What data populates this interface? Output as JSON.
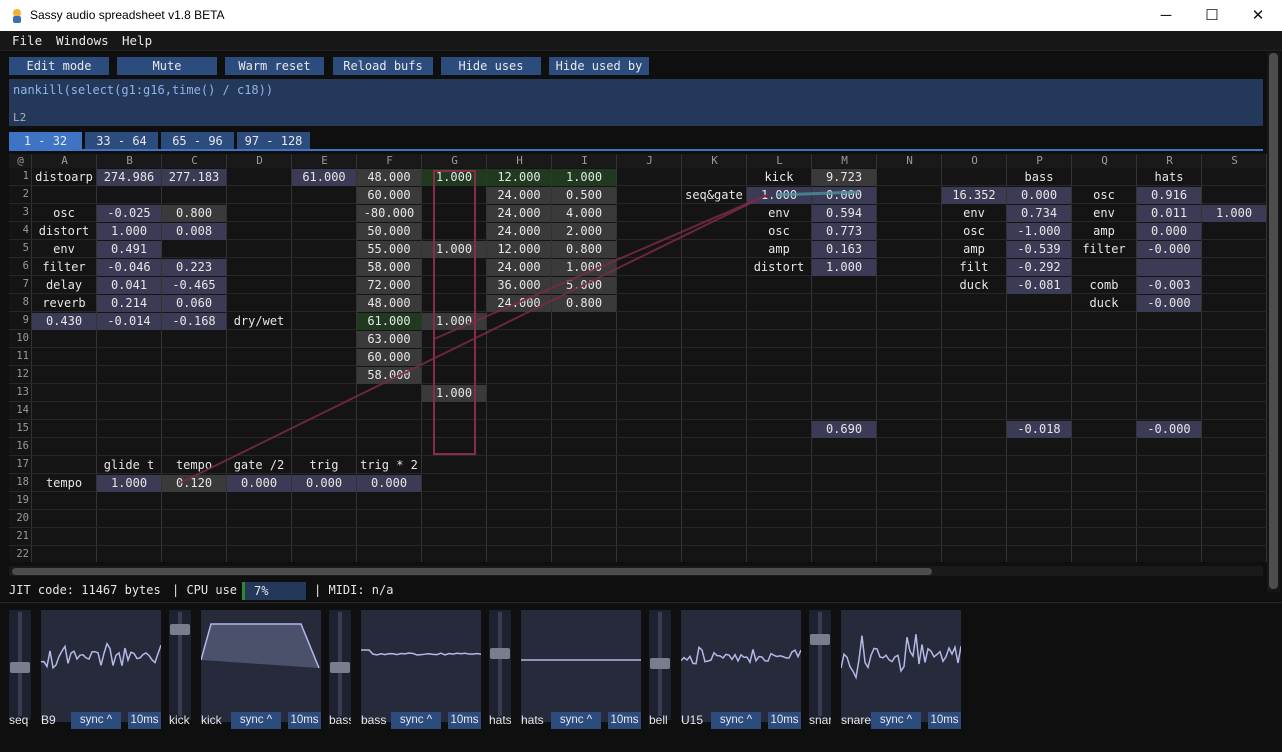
{
  "window": {
    "title": "Sassy audio spreadsheet v1.8 BETA",
    "min": "─",
    "max": "☐",
    "close": "✕"
  },
  "menu": [
    "File",
    "Windows",
    "Help"
  ],
  "toolbar": [
    "Edit mode",
    "Mute",
    "Warm reset",
    "Reload bufs",
    "Hide uses",
    "Hide used by"
  ],
  "formula": {
    "expression": "nankill(select(g1:g16,time() / c18))",
    "cell_ref": "L2"
  },
  "tabs": [
    "1 - 32",
    "33 - 64",
    "65 - 96",
    "97 - 128"
  ],
  "grid": {
    "corner": "@",
    "columns": [
      "A",
      "B",
      "C",
      "D",
      "E",
      "F",
      "G",
      "H",
      "I",
      "J",
      "K",
      "L",
      "M",
      "N",
      "O",
      "P",
      "Q",
      "R",
      "S"
    ],
    "rows": [
      "1",
      "2",
      "3",
      "4",
      "5",
      "6",
      "7",
      "8",
      "9",
      "10",
      "11",
      "12",
      "13",
      "14",
      "15",
      "16",
      "17",
      "18",
      "19",
      "20",
      "21",
      "22"
    ],
    "cells": [
      {
        "c": 0,
        "r": 0,
        "v": "distoarp",
        "s": "t"
      },
      {
        "c": 1,
        "r": 0,
        "v": "274.986",
        "s": "n"
      },
      {
        "c": 2,
        "r": 0,
        "v": "277.183",
        "s": "n"
      },
      {
        "c": 4,
        "r": 0,
        "v": "61.000",
        "s": "n"
      },
      {
        "c": 5,
        "r": 0,
        "v": "48.000",
        "s": "g"
      },
      {
        "c": 6,
        "r": 0,
        "v": "1.000",
        "s": "gr"
      },
      {
        "c": 7,
        "r": 0,
        "v": "12.000",
        "s": "gr"
      },
      {
        "c": 8,
        "r": 0,
        "v": "1.000",
        "s": "gr"
      },
      {
        "c": 11,
        "r": 0,
        "v": "kick",
        "s": "t"
      },
      {
        "c": 12,
        "r": 0,
        "v": "9.723",
        "s": "g"
      },
      {
        "c": 15,
        "r": 0,
        "v": "bass",
        "s": "t"
      },
      {
        "c": 17,
        "r": 0,
        "v": "hats",
        "s": "t"
      },
      {
        "c": 5,
        "r": 1,
        "v": "60.000",
        "s": "g"
      },
      {
        "c": 7,
        "r": 1,
        "v": "24.000",
        "s": "g"
      },
      {
        "c": 8,
        "r": 1,
        "v": "0.500",
        "s": "g"
      },
      {
        "c": 10,
        "r": 1,
        "v": "seq&gate",
        "s": "t"
      },
      {
        "c": 11,
        "r": 1,
        "v": "1.000",
        "s": "n"
      },
      {
        "c": 12,
        "r": 1,
        "v": "0.000",
        "s": "n"
      },
      {
        "c": 14,
        "r": 1,
        "v": "16.352",
        "s": "n"
      },
      {
        "c": 15,
        "r": 1,
        "v": "0.000",
        "s": "n"
      },
      {
        "c": 16,
        "r": 1,
        "v": "osc",
        "s": "t"
      },
      {
        "c": 17,
        "r": 1,
        "v": "0.916",
        "s": "n"
      },
      {
        "c": 0,
        "r": 2,
        "v": "osc",
        "s": "t"
      },
      {
        "c": 1,
        "r": 2,
        "v": "-0.025",
        "s": "n"
      },
      {
        "c": 2,
        "r": 2,
        "v": "0.800",
        "s": "g"
      },
      {
        "c": 5,
        "r": 2,
        "v": "-80.000",
        "s": "g"
      },
      {
        "c": 7,
        "r": 2,
        "v": "24.000",
        "s": "g"
      },
      {
        "c": 8,
        "r": 2,
        "v": "4.000",
        "s": "g"
      },
      {
        "c": 11,
        "r": 2,
        "v": "env",
        "s": "t"
      },
      {
        "c": 12,
        "r": 2,
        "v": "0.594",
        "s": "n"
      },
      {
        "c": 14,
        "r": 2,
        "v": "env",
        "s": "t"
      },
      {
        "c": 15,
        "r": 2,
        "v": "0.734",
        "s": "n"
      },
      {
        "c": 16,
        "r": 2,
        "v": "env",
        "s": "t"
      },
      {
        "c": 17,
        "r": 2,
        "v": "0.011",
        "s": "n"
      },
      {
        "c": 18,
        "r": 2,
        "v": "1.000",
        "s": "n"
      },
      {
        "c": 0,
        "r": 3,
        "v": "distort",
        "s": "t"
      },
      {
        "c": 1,
        "r": 3,
        "v": "1.000",
        "s": "n"
      },
      {
        "c": 2,
        "r": 3,
        "v": "0.008",
        "s": "n"
      },
      {
        "c": 5,
        "r": 3,
        "v": "50.000",
        "s": "g"
      },
      {
        "c": 7,
        "r": 3,
        "v": "24.000",
        "s": "g"
      },
      {
        "c": 8,
        "r": 3,
        "v": "2.000",
        "s": "g"
      },
      {
        "c": 11,
        "r": 3,
        "v": "osc",
        "s": "t"
      },
      {
        "c": 12,
        "r": 3,
        "v": "0.773",
        "s": "n"
      },
      {
        "c": 14,
        "r": 3,
        "v": "osc",
        "s": "t"
      },
      {
        "c": 15,
        "r": 3,
        "v": "-1.000",
        "s": "n"
      },
      {
        "c": 16,
        "r": 3,
        "v": "amp",
        "s": "t"
      },
      {
        "c": 17,
        "r": 3,
        "v": "0.000",
        "s": "n"
      },
      {
        "c": 0,
        "r": 4,
        "v": "env",
        "s": "t"
      },
      {
        "c": 1,
        "r": 4,
        "v": "0.491",
        "s": "n"
      },
      {
        "c": 5,
        "r": 4,
        "v": "55.000",
        "s": "g"
      },
      {
        "c": 6,
        "r": 4,
        "v": "1.000",
        "s": "g"
      },
      {
        "c": 7,
        "r": 4,
        "v": "12.000",
        "s": "g"
      },
      {
        "c": 8,
        "r": 4,
        "v": "0.800",
        "s": "g"
      },
      {
        "c": 11,
        "r": 4,
        "v": "amp",
        "s": "t"
      },
      {
        "c": 12,
        "r": 4,
        "v": "0.163",
        "s": "n"
      },
      {
        "c": 14,
        "r": 4,
        "v": "amp",
        "s": "t"
      },
      {
        "c": 15,
        "r": 4,
        "v": "-0.539",
        "s": "n"
      },
      {
        "c": 16,
        "r": 4,
        "v": "filter",
        "s": "t"
      },
      {
        "c": 17,
        "r": 4,
        "v": "-0.000",
        "s": "n"
      },
      {
        "c": 0,
        "r": 5,
        "v": "filter",
        "s": "t"
      },
      {
        "c": 1,
        "r": 5,
        "v": "-0.046",
        "s": "n"
      },
      {
        "c": 2,
        "r": 5,
        "v": "0.223",
        "s": "n"
      },
      {
        "c": 5,
        "r": 5,
        "v": "58.000",
        "s": "g"
      },
      {
        "c": 7,
        "r": 5,
        "v": "24.000",
        "s": "g"
      },
      {
        "c": 8,
        "r": 5,
        "v": "1.000",
        "s": "g"
      },
      {
        "c": 11,
        "r": 5,
        "v": "distort",
        "s": "t"
      },
      {
        "c": 12,
        "r": 5,
        "v": "1.000",
        "s": "n"
      },
      {
        "c": 14,
        "r": 5,
        "v": "filt",
        "s": "t"
      },
      {
        "c": 15,
        "r": 5,
        "v": "-0.292",
        "s": "n"
      },
      {
        "c": 17,
        "r": 5,
        "v": "",
        "s": "n"
      },
      {
        "c": 0,
        "r": 6,
        "v": "delay",
        "s": "t"
      },
      {
        "c": 1,
        "r": 6,
        "v": "0.041",
        "s": "n"
      },
      {
        "c": 2,
        "r": 6,
        "v": "-0.465",
        "s": "n"
      },
      {
        "c": 5,
        "r": 6,
        "v": "72.000",
        "s": "g"
      },
      {
        "c": 7,
        "r": 6,
        "v": "36.000",
        "s": "g"
      },
      {
        "c": 8,
        "r": 6,
        "v": "5.000",
        "s": "g"
      },
      {
        "c": 14,
        "r": 6,
        "v": "duck",
        "s": "t"
      },
      {
        "c": 15,
        "r": 6,
        "v": "-0.081",
        "s": "n"
      },
      {
        "c": 16,
        "r": 6,
        "v": "comb",
        "s": "t"
      },
      {
        "c": 17,
        "r": 6,
        "v": "-0.003",
        "s": "n"
      },
      {
        "c": 0,
        "r": 7,
        "v": "reverb",
        "s": "t"
      },
      {
        "c": 1,
        "r": 7,
        "v": "0.214",
        "s": "n"
      },
      {
        "c": 2,
        "r": 7,
        "v": "0.060",
        "s": "n"
      },
      {
        "c": 5,
        "r": 7,
        "v": "48.000",
        "s": "g"
      },
      {
        "c": 7,
        "r": 7,
        "v": "24.000",
        "s": "g"
      },
      {
        "c": 8,
        "r": 7,
        "v": "0.800",
        "s": "g"
      },
      {
        "c": 16,
        "r": 7,
        "v": "duck",
        "s": "t"
      },
      {
        "c": 17,
        "r": 7,
        "v": "-0.000",
        "s": "n"
      },
      {
        "c": 0,
        "r": 8,
        "v": "0.430",
        "s": "n"
      },
      {
        "c": 1,
        "r": 8,
        "v": "-0.014",
        "s": "n"
      },
      {
        "c": 2,
        "r": 8,
        "v": "-0.168",
        "s": "n"
      },
      {
        "c": 3,
        "r": 8,
        "v": "dry/wet",
        "s": "t"
      },
      {
        "c": 5,
        "r": 8,
        "v": "61.000",
        "s": "gr"
      },
      {
        "c": 6,
        "r": 8,
        "v": "1.000",
        "s": "g"
      },
      {
        "c": 5,
        "r": 9,
        "v": "63.000",
        "s": "g"
      },
      {
        "c": 5,
        "r": 10,
        "v": "60.000",
        "s": "g"
      },
      {
        "c": 5,
        "r": 11,
        "v": "58.000",
        "s": "g"
      },
      {
        "c": 6,
        "r": 12,
        "v": "1.000",
        "s": "g"
      },
      {
        "c": 12,
        "r": 14,
        "v": "0.690",
        "s": "n"
      },
      {
        "c": 15,
        "r": 14,
        "v": "-0.018",
        "s": "n"
      },
      {
        "c": 17,
        "r": 14,
        "v": "-0.000",
        "s": "n"
      },
      {
        "c": 1,
        "r": 16,
        "v": "glide t",
        "s": "t"
      },
      {
        "c": 2,
        "r": 16,
        "v": "tempo",
        "s": "t"
      },
      {
        "c": 3,
        "r": 16,
        "v": "gate /2",
        "s": "t"
      },
      {
        "c": 4,
        "r": 16,
        "v": "trig",
        "s": "t"
      },
      {
        "c": 5,
        "r": 16,
        "v": "trig * 2",
        "s": "t"
      },
      {
        "c": 0,
        "r": 17,
        "v": "tempo",
        "s": "t"
      },
      {
        "c": 1,
        "r": 17,
        "v": "1.000",
        "s": "n"
      },
      {
        "c": 2,
        "r": 17,
        "v": "0.120",
        "s": "g"
      },
      {
        "c": 3,
        "r": 17,
        "v": "0.000",
        "s": "n"
      },
      {
        "c": 4,
        "r": 17,
        "v": "0.000",
        "s": "n"
      },
      {
        "c": 5,
        "r": 17,
        "v": "0.000",
        "s": "n"
      }
    ]
  },
  "status": {
    "jit": "JIT code: 11467 bytes",
    "cpu_label": "| CPU use",
    "cpu_value": "7%",
    "cpu_fraction": 0.07,
    "midi": "| MIDI: n/a"
  },
  "instruments": [
    {
      "slider_label": "seq",
      "scope_label": "B9",
      "sync": "sync ^",
      "ms": "10ms",
      "level": 0.45,
      "shape": "noise1"
    },
    {
      "slider_label": "kick",
      "scope_label": "kick",
      "sync": "sync ^",
      "ms": "10ms",
      "level": 0.85,
      "shape": "trap"
    },
    {
      "slider_label": "bass",
      "scope_label": "bass",
      "sync": "sync ^",
      "ms": "10ms",
      "level": 0.45,
      "shape": "flat1"
    },
    {
      "slider_label": "hats",
      "scope_label": "hats",
      "sync": "sync ^",
      "ms": "10ms",
      "level": 0.6,
      "shape": "flat2"
    },
    {
      "slider_label": "bell",
      "scope_label": "U15",
      "sync": "sync ^",
      "ms": "10ms",
      "level": 0.5,
      "shape": "noise2"
    },
    {
      "slider_label": "snare",
      "scope_label": "snare",
      "sync": "sync ^",
      "ms": "10ms",
      "level": 0.75,
      "shape": "noise3"
    }
  ]
}
